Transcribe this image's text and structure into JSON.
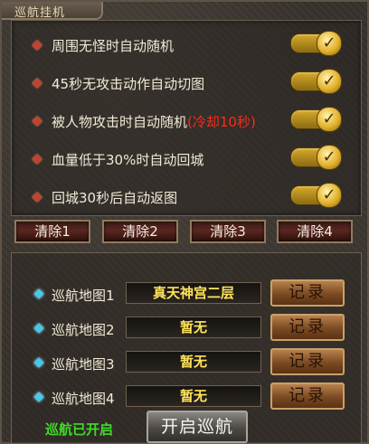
{
  "window": {
    "title": "巡航挂机"
  },
  "options": [
    {
      "label": "周围无怪时自动随机",
      "extra": "",
      "checked": true
    },
    {
      "label": "45秒无攻击动作自动切图",
      "extra": "",
      "checked": true
    },
    {
      "label": "被人物攻击时自动随机",
      "extra": "(冷却10秒)",
      "checked": true
    },
    {
      "label": "血量低于30%时自动回城",
      "extra": "",
      "checked": true
    },
    {
      "label": "回城30秒后自动返图",
      "extra": "",
      "checked": true
    }
  ],
  "check_glyph": "✓",
  "clear_buttons": [
    "清除1",
    "清除2",
    "清除3",
    "清除4"
  ],
  "maps": [
    {
      "label": "巡航地图1",
      "value": "真天神宫二层",
      "button": "记录"
    },
    {
      "label": "巡航地图2",
      "value": "暂无",
      "button": "记录"
    },
    {
      "label": "巡航地图3",
      "value": "暂无",
      "button": "记录"
    },
    {
      "label": "巡航地图4",
      "value": "暂无",
      "button": "记录"
    }
  ],
  "footer": {
    "status": "巡航已开启",
    "start_button": "开启巡航"
  },
  "colors": {
    "accent_gold": "#e3b22c",
    "cooldown_red": "#ff2a1a",
    "status_green": "#3edc28",
    "map_value_yellow": "#ffe35a"
  },
  "icons": {
    "option_bullet": "red-diamond-icon",
    "map_bullet": "cyan-gem-icon",
    "toggle_check": "check-icon"
  }
}
